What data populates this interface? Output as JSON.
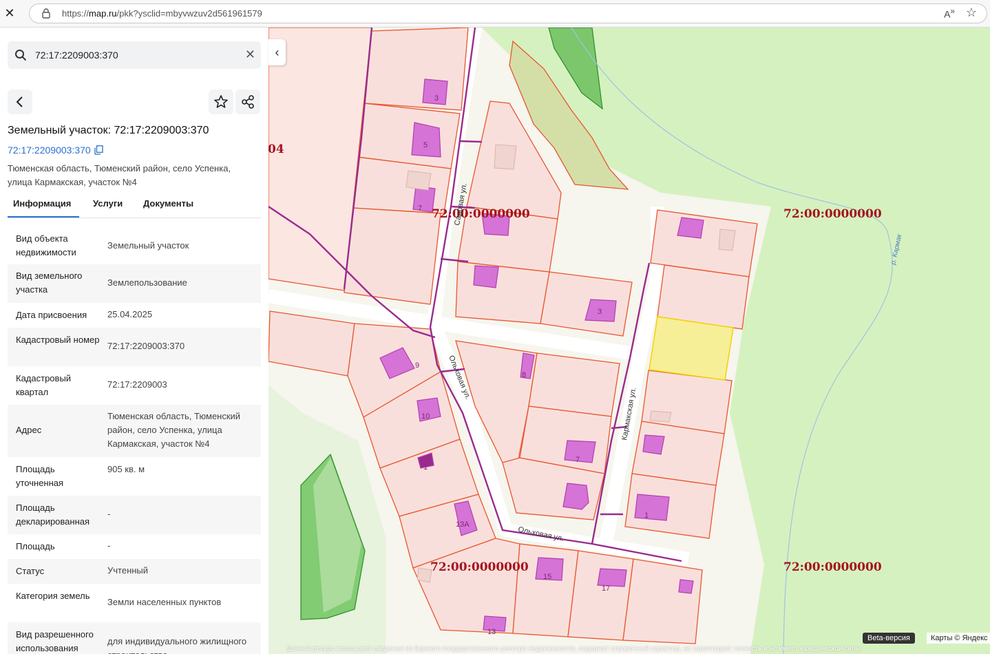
{
  "browser": {
    "url_prefix": "https://",
    "url_domain": "map.ru",
    "url_path": "/pkk?ysclid=mbyvwzuv2d561961579"
  },
  "panel": {
    "search_value": "72:17:2209003:370",
    "title": "Земельный участок: 72:17:2209003:370",
    "cadastral_link": "72:17:2209003:370",
    "address": "Тюменская область, Тюменский район, село Успенка, улица Кармакская, участок №4",
    "tabs": [
      "Информация",
      "Услуги",
      "Документы"
    ],
    "rows": [
      {
        "label": "Вид объекта недвижимости",
        "value": "Земельный участок"
      },
      {
        "label": "Вид земельного участка",
        "value": "Землепользование"
      },
      {
        "label": "Дата присвоения",
        "value": "25.04.2025"
      },
      {
        "label": "Кадастровый номер",
        "value": "72:17:2209003:370"
      },
      {
        "label": "Кадастровый квартал",
        "value": "72:17:2209003"
      },
      {
        "label": "Адрес",
        "value": "Тюменская область, Тюменский район, село Успенка, улица Кармакская, участок №4"
      },
      {
        "label": "Площадь уточненная",
        "value": "905 кв. м"
      },
      {
        "label": "Площадь декларированная",
        "value": "-"
      },
      {
        "label": "Площадь",
        "value": "-"
      },
      {
        "label": "Статус",
        "value": "Учтенный"
      },
      {
        "label": "Категория земель",
        "value": "Земли населенных пунктов"
      },
      {
        "label": "Вид разрешенного использования",
        "value": "для индивидуального жилищного строительства"
      }
    ]
  },
  "map": {
    "region_labels": [
      "72:00:0000000",
      "72:00:0000000",
      "72:00:0000000",
      "72:00:0000000"
    ],
    "partial_label": "04",
    "streets": [
      "Садовая ул.",
      "Ольховая ул.",
      "Кармакская ул.",
      "Ольховая ул."
    ],
    "river": "р. Кармак",
    "house_numbers": [
      "3",
      "5",
      "7",
      "3",
      "9",
      "8",
      "10",
      "7",
      "1",
      "13А",
      "1",
      "15",
      "17",
      "13"
    ],
    "beta_label": "Beta-версия",
    "copyright": "Карты © Яндекс",
    "disclaimer": "Данный ресурс использует сведения из Единого государственного реестра недвижимости, содержит справочный характер, не гарантирует точность и не имеет юридической силы"
  },
  "colors": {
    "accent": "#2b6fd1",
    "parcel_fill": "#f8e0dc",
    "parcel_stroke": "#e8562e",
    "selected_parcel": "#f7ee98",
    "building": "#d673d6",
    "forest": "#d5f0bf",
    "map_label": "#a4141f"
  }
}
